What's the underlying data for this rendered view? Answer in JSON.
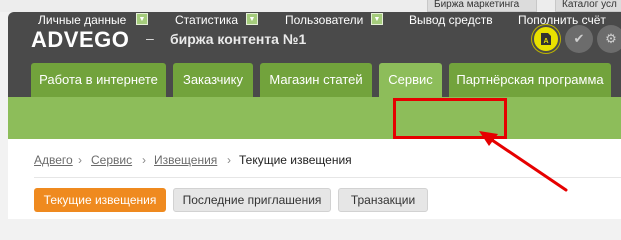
{
  "top_links": [
    "Биржа маркетинга",
    "Каталог усл"
  ],
  "header": {
    "logo": "ADVEGO",
    "dash": "–",
    "tagline": "биржа контента №1",
    "icons": [
      "article-icon",
      "check-icon",
      "gear-icon"
    ]
  },
  "tabs": [
    {
      "label": "Работа в интернете",
      "active": false
    },
    {
      "label": "Заказчику",
      "active": false
    },
    {
      "label": "Магазин статей",
      "active": false
    },
    {
      "label": "Сервис",
      "active": true
    },
    {
      "label": "Партнёрская программа",
      "active": false
    }
  ],
  "subnav": [
    {
      "label": "Личные данные",
      "dropdown": true
    },
    {
      "label": "Статистика",
      "dropdown": true
    },
    {
      "label": "Пользователи",
      "dropdown": true
    },
    {
      "label": "Вывод средств",
      "dropdown": false,
      "highlighted": true
    },
    {
      "label": "Пополнить счёт",
      "dropdown": false
    }
  ],
  "breadcrumb": {
    "items": [
      "Адвего",
      "Сервис",
      "Извещения"
    ],
    "separator": "›",
    "current": "Текущие извещения"
  },
  "buttons": [
    {
      "label": "Текущие извещения",
      "active": true
    },
    {
      "label": "Последние приглашения",
      "active": false
    },
    {
      "label": "Транзакции",
      "active": false
    }
  ],
  "annotation_color": "#e60000"
}
